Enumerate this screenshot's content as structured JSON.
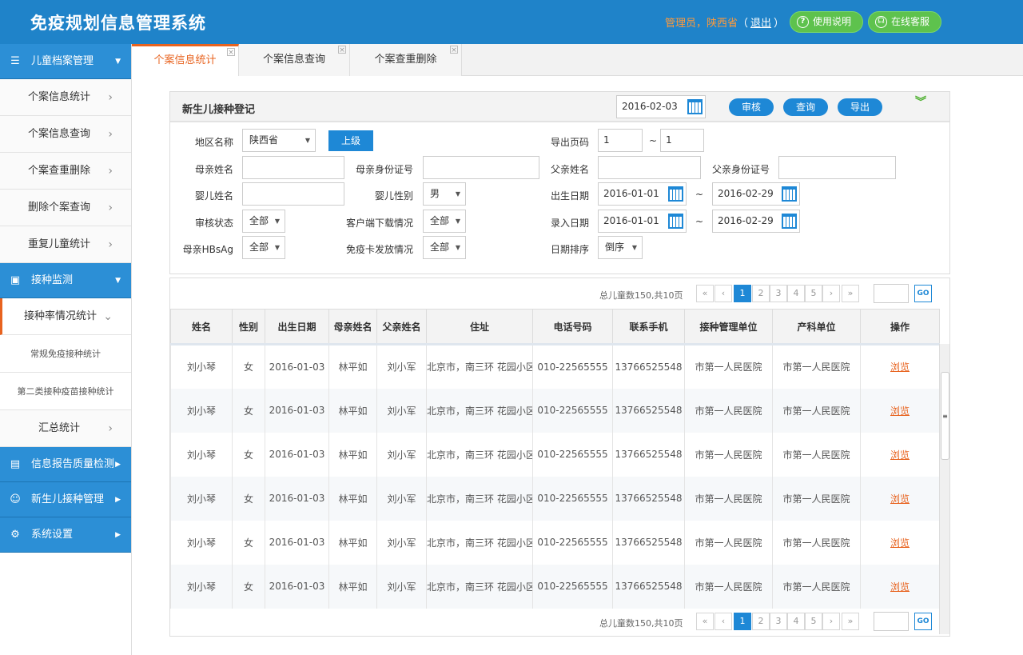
{
  "header": {
    "title": "免疫规划信息管理系统",
    "user_role": "管理员，陕西省",
    "paren_open": "（",
    "logout": "退出",
    "paren_close": "）",
    "help": "使用说明",
    "service": "在线客服"
  },
  "sidebar": {
    "group1": "儿童档案管理",
    "items1": [
      "个案信息统计",
      "个案信息查询",
      "个案查重删除",
      "删除个案查询",
      "重复儿童统计"
    ],
    "group2": "接种监测",
    "active_item": "接种率情况统计",
    "sub_items": [
      "常规免疫接种统计",
      "第二类接种疫苗接种统计"
    ],
    "summary": "汇总统计",
    "group3": "信息报告质量检测",
    "group4": "新生儿接种管理",
    "group5": "系统设置"
  },
  "tabs": [
    "个案信息统计",
    "个案信息查询",
    "个案查重删除"
  ],
  "form": {
    "title": "新生儿接种登记",
    "date": "2016-02-03",
    "btn_audit": "审核",
    "btn_query": "查询",
    "btn_export": "导出",
    "region_label": "地区名称",
    "region_value": "陕西省",
    "up_btn": "上级",
    "export_page_label": "导出页码",
    "export_from": "1",
    "tilde": "~",
    "export_to": "1",
    "mother_name_label": "母亲姓名",
    "mother_id_label": "母亲身份证号",
    "father_name_label": "父亲姓名",
    "father_id_label": "父亲身份证号",
    "baby_name_label": "婴儿姓名",
    "baby_gender_label": "婴儿性别",
    "baby_gender_value": "男",
    "birth_date_label": "出生日期",
    "birth_from": "2016-01-01",
    "birth_to": "2016-02-29",
    "audit_status_label": "审核状态",
    "audit_status_value": "全部",
    "client_download_label": "客户端下载情况",
    "client_download_value": "全部",
    "entry_date_label": "录入日期",
    "entry_from": "2016-01-01",
    "entry_to": "2016-02-29",
    "hbsag_label": "母亲HBsAg",
    "hbsag_value": "全部",
    "card_label": "免疫卡发放情况",
    "card_value": "全部",
    "sort_label": "日期排序",
    "sort_value": "倒序"
  },
  "pager": {
    "total": "总儿童数150,共10页",
    "first": "«",
    "prev": "‹",
    "pages": [
      "1",
      "2",
      "3",
      "4",
      "5"
    ],
    "next": "›",
    "last": "»",
    "go": "GO"
  },
  "table": {
    "headers": [
      "姓名",
      "性别",
      "出生日期",
      "母亲姓名",
      "父亲姓名",
      "住址",
      "电话号码",
      "联系手机",
      "接种管理单位",
      "产科单位",
      "操作"
    ],
    "rows": [
      [
        "刘小琴",
        "女",
        "2016-01-03",
        "林平如",
        "刘小军",
        "北京市，南三环 花园小区",
        "010-22565555",
        "13766525548",
        "市第一人民医院",
        "市第一人民医院",
        "浏览"
      ],
      [
        "刘小琴",
        "女",
        "2016-01-03",
        "林平如",
        "刘小军",
        "北京市，南三环 花园小区",
        "010-22565555",
        "13766525548",
        "市第一人民医院",
        "市第一人民医院",
        "浏览"
      ],
      [
        "刘小琴",
        "女",
        "2016-01-03",
        "林平如",
        "刘小军",
        "北京市，南三环 花园小区",
        "010-22565555",
        "13766525548",
        "市第一人民医院",
        "市第一人民医院",
        "浏览"
      ],
      [
        "刘小琴",
        "女",
        "2016-01-03",
        "林平如",
        "刘小军",
        "北京市，南三环 花园小区",
        "010-22565555",
        "13766525548",
        "市第一人民医院",
        "市第一人民医院",
        "浏览"
      ],
      [
        "刘小琴",
        "女",
        "2016-01-03",
        "林平如",
        "刘小军",
        "北京市，南三环 花园小区",
        "010-22565555",
        "13766525548",
        "市第一人民医院",
        "市第一人民医院",
        "浏览"
      ],
      [
        "刘小琴",
        "女",
        "2016-01-03",
        "林平如",
        "刘小军",
        "北京市，南三环 花园小区",
        "010-22565555",
        "13766525548",
        "市第一人民医院",
        "市第一人民医院",
        "浏览"
      ]
    ]
  }
}
